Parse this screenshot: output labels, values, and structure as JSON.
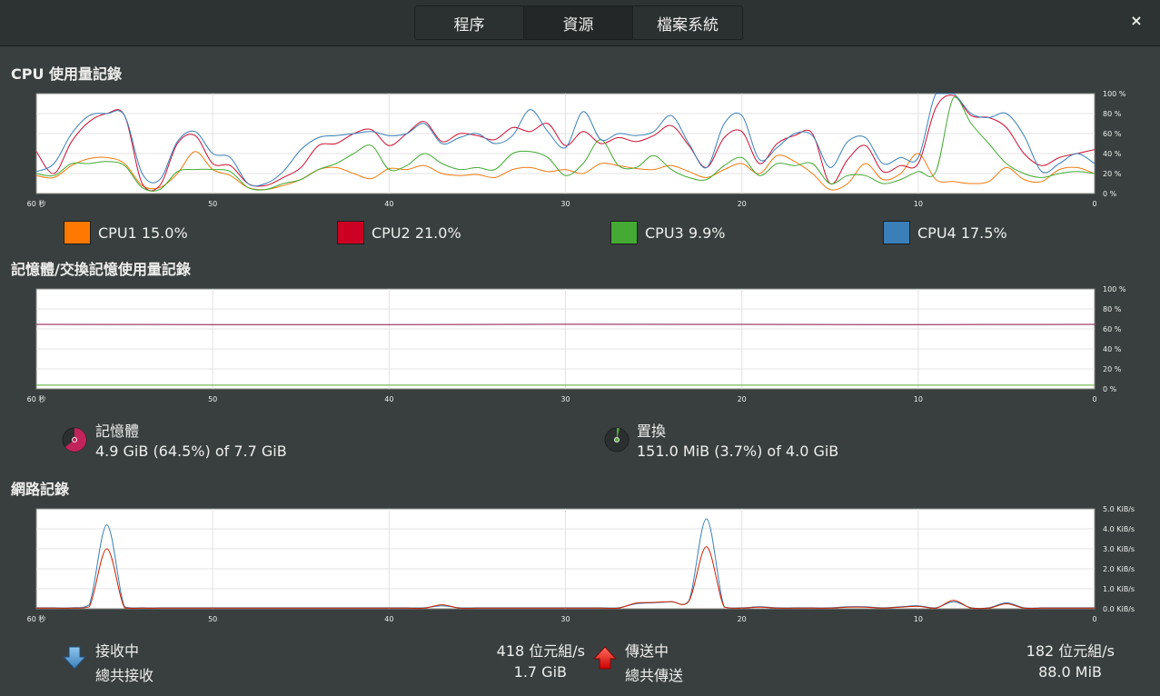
{
  "tabs": [
    {
      "label": "程序",
      "active": false
    },
    {
      "label": "資源",
      "active": true
    },
    {
      "label": "檔案系統",
      "active": false
    }
  ],
  "close_label": "×",
  "cpu": {
    "title": "CPU 使用量記錄",
    "legend": [
      {
        "name": "CPU1",
        "value": "15.0%",
        "color": "#ff7800"
      },
      {
        "name": "CPU2",
        "value": "21.0%",
        "color": "#cc0022"
      },
      {
        "name": "CPU3",
        "value": "9.9%",
        "color": "#44aa33"
      },
      {
        "name": "CPU4",
        "value": "17.5%",
        "color": "#3a7fb8"
      }
    ]
  },
  "memory": {
    "title": "記憶體/交換記憶使用量記錄",
    "mem_label": "記憶體",
    "mem_value": "4.9 GiB (64.5%) of 7.7 GiB",
    "mem_fraction": 0.645,
    "mem_color": "#c0245a",
    "swap_label": "置換",
    "swap_value": "151.0 MiB (3.7%) of 4.0 GiB",
    "swap_fraction": 0.037,
    "swap_color": "#55aa33"
  },
  "network": {
    "title": "網路記錄",
    "recv_label": "接收中",
    "recv_total_label": "總共接收",
    "recv_rate": "418 位元組/s",
    "recv_total": "1.7 GiB",
    "send_label": "傳送中",
    "send_total_label": "總共傳送",
    "send_rate": "182 位元組/s",
    "send_total": "88.0 MiB"
  },
  "chart_data": [
    {
      "type": "line",
      "x": [
        60,
        59,
        58,
        57,
        56,
        55,
        54,
        53,
        52,
        51,
        50,
        49,
        48,
        47,
        46,
        45,
        44,
        43,
        42,
        41,
        40,
        39,
        38,
        37,
        36,
        35,
        34,
        33,
        32,
        31,
        30,
        29,
        28,
        27,
        26,
        25,
        24,
        23,
        22,
        21,
        20,
        19,
        18,
        17,
        16,
        15,
        14,
        13,
        12,
        11,
        10,
        9,
        8,
        7,
        6,
        5,
        4,
        3,
        2,
        1,
        0
      ],
      "xticks": [
        "60 秒",
        "50",
        "40",
        "30",
        "20",
        "10",
        "0"
      ],
      "yticks": [
        "100 %",
        "80 %",
        "60 %",
        "40 %",
        "20 %",
        "0 %"
      ],
      "ylim": [
        0,
        100
      ],
      "series": [
        {
          "name": "CPU1",
          "color": "#f07a10",
          "values": [
            18,
            16,
            28,
            35,
            36,
            30,
            8,
            6,
            20,
            42,
            24,
            18,
            6,
            4,
            8,
            14,
            24,
            26,
            20,
            15,
            25,
            24,
            28,
            20,
            18,
            19,
            16,
            24,
            26,
            22,
            24,
            20,
            30,
            28,
            25,
            24,
            28,
            22,
            16,
            24,
            30,
            20,
            38,
            32,
            20,
            4,
            10,
            30,
            14,
            20,
            40,
            14,
            12,
            10,
            12,
            26,
            14,
            12,
            24,
            26,
            20
          ]
        },
        {
          "name": "CPU2",
          "color": "#cc1133",
          "values": [
            42,
            20,
            52,
            72,
            80,
            78,
            10,
            8,
            50,
            58,
            30,
            28,
            10,
            8,
            16,
            26,
            48,
            50,
            60,
            64,
            48,
            60,
            72,
            52,
            60,
            58,
            54,
            66,
            62,
            70,
            48,
            62,
            50,
            56,
            52,
            58,
            68,
            48,
            26,
            56,
            62,
            30,
            50,
            58,
            60,
            10,
            34,
            48,
            22,
            28,
            30,
            86,
            98,
            78,
            76,
            66,
            40,
            28,
            36,
            40,
            44
          ]
        },
        {
          "name": "CPU3",
          "color": "#44aa33",
          "values": [
            20,
            18,
            30,
            30,
            32,
            28,
            6,
            4,
            22,
            24,
            24,
            22,
            6,
            4,
            10,
            14,
            24,
            30,
            40,
            48,
            24,
            28,
            40,
            30,
            24,
            26,
            24,
            40,
            42,
            36,
            18,
            30,
            54,
            28,
            26,
            38,
            24,
            16,
            14,
            28,
            36,
            18,
            30,
            28,
            30,
            10,
            18,
            18,
            10,
            14,
            22,
            22,
            96,
            70,
            50,
            30,
            20,
            16,
            20,
            22,
            20
          ]
        },
        {
          "name": "CPU4",
          "color": "#3a7fb8",
          "values": [
            22,
            30,
            60,
            78,
            80,
            78,
            20,
            14,
            52,
            62,
            40,
            36,
            10,
            10,
            22,
            44,
            56,
            58,
            60,
            62,
            58,
            60,
            70,
            50,
            56,
            60,
            50,
            58,
            84,
            62,
            46,
            82,
            54,
            60,
            58,
            62,
            78,
            50,
            26,
            70,
            78,
            34,
            46,
            60,
            58,
            26,
            52,
            56,
            30,
            36,
            36,
            100,
            100,
            80,
            76,
            80,
            58,
            22,
            30,
            40,
            30
          ]
        }
      ]
    },
    {
      "type": "line",
      "x": [
        60,
        50,
        40,
        30,
        20,
        10,
        0
      ],
      "xticks": [
        "60 秒",
        "50",
        "40",
        "30",
        "20",
        "10",
        "0"
      ],
      "yticks": [
        "100 %",
        "80 %",
        "60 %",
        "40 %",
        "20 %",
        "0 %"
      ],
      "ylim": [
        0,
        100
      ],
      "series": [
        {
          "name": "記憶體",
          "color": "#8a1144",
          "values": [
            64.5,
            64.4,
            64.4,
            64.6,
            64.5,
            64.4,
            64.5
          ]
        },
        {
          "name": "置換",
          "color": "#55aa33",
          "values": [
            3.7,
            3.7,
            3.7,
            3.7,
            3.7,
            3.7,
            3.7
          ]
        }
      ]
    },
    {
      "type": "line",
      "x": [
        60,
        59,
        58,
        57,
        56,
        55,
        54,
        53,
        52,
        51,
        50,
        49,
        48,
        47,
        46,
        45,
        44,
        43,
        42,
        41,
        40,
        39,
        38,
        37,
        36,
        35,
        34,
        33,
        32,
        31,
        30,
        29,
        28,
        27,
        26,
        25,
        24,
        23,
        22,
        21,
        20,
        19,
        18,
        17,
        16,
        15,
        14,
        13,
        12,
        11,
        10,
        9,
        8,
        7,
        6,
        5,
        4,
        3,
        2,
        1,
        0
      ],
      "xticks": [
        "60 秒",
        "50",
        "40",
        "30",
        "20",
        "10",
        "0"
      ],
      "yticks": [
        "5.0 KiB/s",
        "4.0 KiB/s",
        "3.0 KiB/s",
        "2.0 KiB/s",
        "1.0 KiB/s",
        "0.0 KiB/s"
      ],
      "ylim": [
        0,
        5
      ],
      "series": [
        {
          "name": "接收中",
          "color": "#3a7fb8",
          "values": [
            0.05,
            0.05,
            0.05,
            0.2,
            4.2,
            0.1,
            0.05,
            0.05,
            0.05,
            0.05,
            0.05,
            0.05,
            0.05,
            0.05,
            0.05,
            0.05,
            0.05,
            0.05,
            0.05,
            0.05,
            0.05,
            0.05,
            0.05,
            0.15,
            0.05,
            0.05,
            0.05,
            0.05,
            0.05,
            0.05,
            0.05,
            0.05,
            0.05,
            0.05,
            0.25,
            0.3,
            0.35,
            0.4,
            4.5,
            0.1,
            0.05,
            0.1,
            0.05,
            0.05,
            0.05,
            0.05,
            0.1,
            0.1,
            0.05,
            0.1,
            0.15,
            0.05,
            0.35,
            0.05,
            0.05,
            0.3,
            0.05,
            0.05,
            0.05,
            0.05,
            0.05
          ]
        },
        {
          "name": "傳送中",
          "color": "#cc2200",
          "values": [
            0.03,
            0.03,
            0.03,
            0.1,
            3.0,
            0.05,
            0.03,
            0.03,
            0.03,
            0.03,
            0.03,
            0.03,
            0.03,
            0.03,
            0.03,
            0.03,
            0.03,
            0.03,
            0.03,
            0.03,
            0.03,
            0.03,
            0.03,
            0.2,
            0.03,
            0.03,
            0.03,
            0.03,
            0.03,
            0.03,
            0.03,
            0.03,
            0.03,
            0.03,
            0.28,
            0.32,
            0.36,
            0.38,
            3.1,
            0.08,
            0.03,
            0.08,
            0.03,
            0.03,
            0.03,
            0.03,
            0.08,
            0.08,
            0.03,
            0.08,
            0.12,
            0.03,
            0.42,
            0.03,
            0.03,
            0.25,
            0.03,
            0.03,
            0.03,
            0.03,
            0.03
          ]
        }
      ]
    }
  ]
}
